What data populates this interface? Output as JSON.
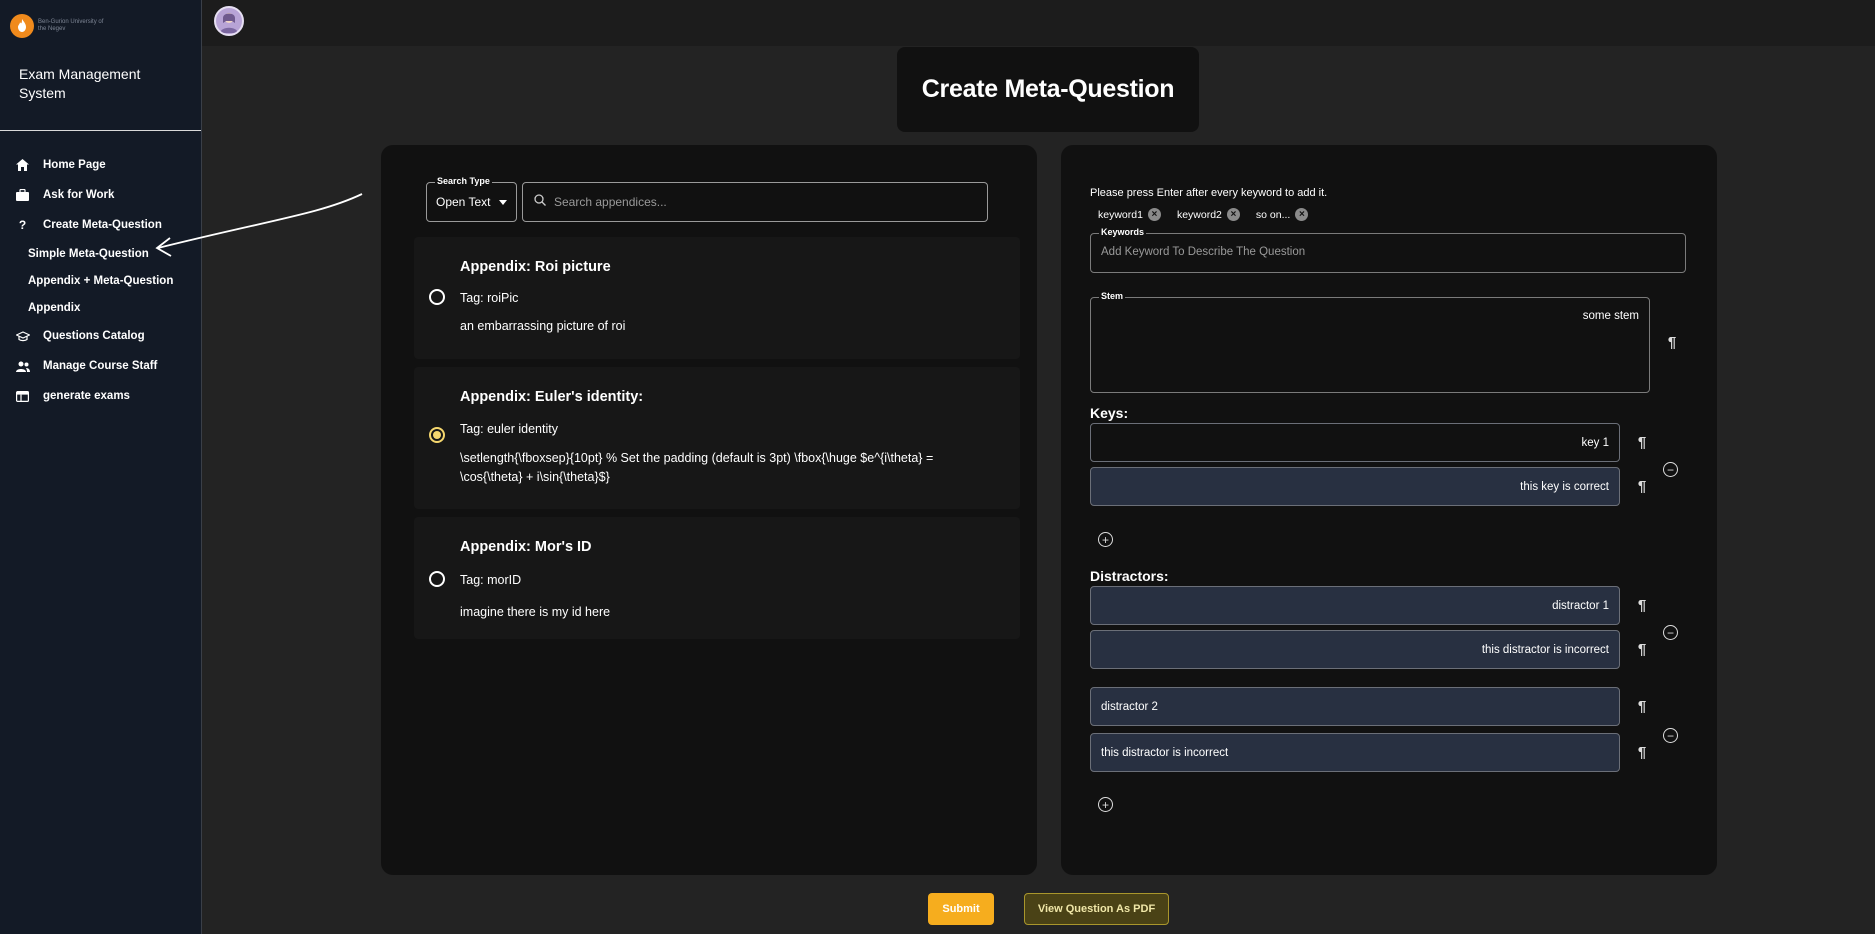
{
  "sidebar": {
    "logo_text": "Ben-Gurion University of the Negev",
    "app_title": "Exam Management System",
    "nav": [
      {
        "label": "Home Page",
        "icon": "home-icon"
      },
      {
        "label": "Ask for Work",
        "icon": "briefcase-icon"
      },
      {
        "label": "Create Meta-Question",
        "icon": "question-icon"
      },
      {
        "label": "Questions Catalog",
        "icon": "graduation-cap-icon"
      },
      {
        "label": "Manage Course Staff",
        "icon": "people-icon"
      },
      {
        "label": "generate exams",
        "icon": "table-icon"
      }
    ],
    "sub_nav": [
      {
        "label": "Simple Meta-Question"
      },
      {
        "label": "Appendix + Meta-Question"
      },
      {
        "label": "Appendix"
      }
    ]
  },
  "page": {
    "title": "Create Meta-Question"
  },
  "search": {
    "type_label": "Search Type",
    "type_value": "Open Text",
    "placeholder": "Search appendices..."
  },
  "appendices": [
    {
      "title": "Appendix: Roi picture",
      "tag": "Tag: roiPic",
      "content": "an embarrassing picture of roi",
      "selected": false
    },
    {
      "title": "Appendix: Euler's identity:",
      "tag": "Tag: euler identity",
      "content": "\\setlength{\\fboxsep}{10pt} % Set the padding (default is 3pt) \\fbox{\\huge $e^{i\\theta} = \\cos{\\theta} + i\\sin{\\theta}$}",
      "selected": true
    },
    {
      "title": "Appendix: Mor's ID",
      "tag": "Tag: morID",
      "content": "imagine there is my id here",
      "selected": false
    }
  ],
  "form": {
    "hint": "Please press Enter after every keyword to add it.",
    "keywords": [
      "keyword1",
      "keyword2",
      "so on..."
    ],
    "keywords_label": "Keywords",
    "keywords_placeholder": "Add Keyword To Describe The Question",
    "stem_label": "Stem",
    "stem_value": "some stem",
    "keys_label": "Keys:",
    "keys": [
      {
        "answer": "key 1",
        "explanation": "this key is correct"
      }
    ],
    "distractors_label": "Distractors:",
    "distractors": [
      {
        "answer": "distractor 1",
        "explanation": "this distractor is incorrect"
      },
      {
        "answer": "distractor 2",
        "explanation": "this distractor is incorrect"
      }
    ]
  },
  "buttons": {
    "submit": "Submit",
    "pdf": "View Question As PDF"
  },
  "colors": {
    "accent": "#f6ad1e",
    "sidebar_bg": "#131a26",
    "panel_bg": "#111111",
    "filled_input": "#283041"
  }
}
